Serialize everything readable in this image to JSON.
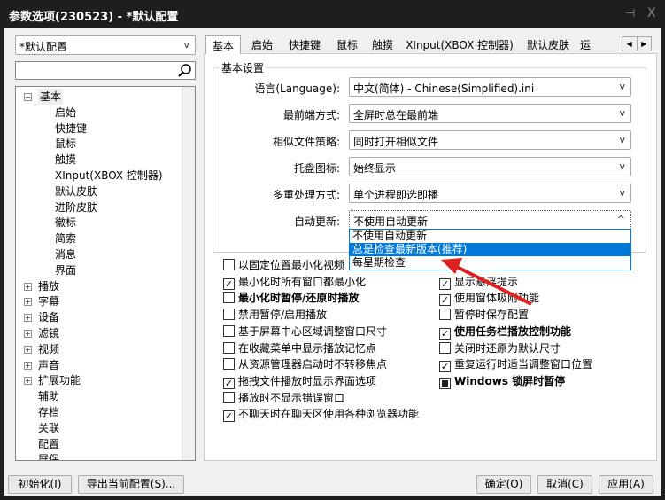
{
  "window": {
    "title": "参数选项(230523) - *默认配置",
    "pin_icon": "pin-icon",
    "close_label": "X"
  },
  "profile_select": {
    "value": "*默认配置"
  },
  "search": {
    "value": "",
    "icon": "search-icon"
  },
  "tree": [
    {
      "label": "基本",
      "level": 0,
      "toggle": "−"
    },
    {
      "label": "启始",
      "level": 1
    },
    {
      "label": "快捷键",
      "level": 1
    },
    {
      "label": "鼠标",
      "level": 1
    },
    {
      "label": "触摸",
      "level": 1
    },
    {
      "label": "XInput(XBOX 控制器)",
      "level": 1
    },
    {
      "label": "默认皮肤",
      "level": 1
    },
    {
      "label": "进阶皮肤",
      "level": 1
    },
    {
      "label": "徽标",
      "level": 1
    },
    {
      "label": "简索",
      "level": 1
    },
    {
      "label": "消息",
      "level": 1
    },
    {
      "label": "界面",
      "level": 1
    },
    {
      "label": "播放",
      "level": 0,
      "toggle": "+"
    },
    {
      "label": "字幕",
      "level": 0,
      "toggle": "+"
    },
    {
      "label": "设备",
      "level": 0,
      "toggle": "+"
    },
    {
      "label": "滤镜",
      "level": 0,
      "toggle": "+"
    },
    {
      "label": "视频",
      "level": 0,
      "toggle": "+"
    },
    {
      "label": "声音",
      "level": 0,
      "toggle": "+"
    },
    {
      "label": "扩展功能",
      "level": 0,
      "toggle": "+"
    },
    {
      "label": "辅助",
      "level": 0
    },
    {
      "label": "存档",
      "level": 0
    },
    {
      "label": "关联",
      "level": 0
    },
    {
      "label": "配置",
      "level": 0
    },
    {
      "label": "屏保",
      "level": 0
    }
  ],
  "tabs": [
    "基本",
    "启始",
    "快捷键",
    "鼠标",
    "触摸",
    "XInput(XBOX 控制器)",
    "默认皮肤",
    "运"
  ],
  "group": {
    "title": "基本设置"
  },
  "settings": [
    {
      "label": "语言(Language):",
      "value": "中文(简体) - Chinese(Simplified).ini"
    },
    {
      "label": "最前端方式:",
      "value": "全屏时总在最前端"
    },
    {
      "label": "相似文件策略:",
      "value": "同时打开相似文件"
    },
    {
      "label": "托盘图标:",
      "value": "始终显示"
    },
    {
      "label": "多重处理方式:",
      "value": "单个进程即选即播"
    },
    {
      "label": "自动更新:",
      "value": "不使用自动更新"
    }
  ],
  "update_options": [
    "不使用自动更新",
    "总是检查最新版本(推荐)",
    "每星期检查"
  ],
  "update_highlighted": 1,
  "checks_left": [
    {
      "label": "以固定位置最小化视频",
      "checked": false
    },
    {
      "label": "最小化时所有窗口都最小化",
      "checked": true
    },
    {
      "label": "最小化时暂停/还原时播放",
      "checked": false,
      "bold": true
    },
    {
      "label": "禁用暂停/启用播放",
      "checked": false
    },
    {
      "label": "基于屏幕中心区域调整窗口尺寸",
      "checked": false
    },
    {
      "label": "在收藏菜单中显示播放记忆点",
      "checked": false
    },
    {
      "label": "从资源管理器启动时不转移焦点",
      "checked": false
    },
    {
      "label": "拖拽文件播放时显示界面选项",
      "checked": true
    },
    {
      "label": "播放时不显示错误窗口",
      "checked": false
    },
    {
      "label": "不聊天时在聊天区使用各种浏览器功能",
      "checked": true
    }
  ],
  "checks_right": [
    {
      "label": "显示悬浮提示",
      "checked": true
    },
    {
      "label": "使用窗体吸附功能",
      "checked": true
    },
    {
      "label": "暂停时保存配置",
      "checked": false
    },
    {
      "label": "使用任务栏播放控制功能",
      "checked": true,
      "bold": true
    },
    {
      "label": "关闭时还原为默认尺寸",
      "checked": false
    },
    {
      "label": "重复运行时适当调整窗口位置",
      "checked": true
    },
    {
      "label": "Windows 锁屏时暂停",
      "checked": "partial",
      "bold": true
    }
  ],
  "buttons": {
    "init": "初始化(I)",
    "export": "导出当前配置(S)...",
    "ok": "确定(O)",
    "cancel": "取消(C)",
    "apply": "应用(A)"
  },
  "annotation_color": "#e02020"
}
